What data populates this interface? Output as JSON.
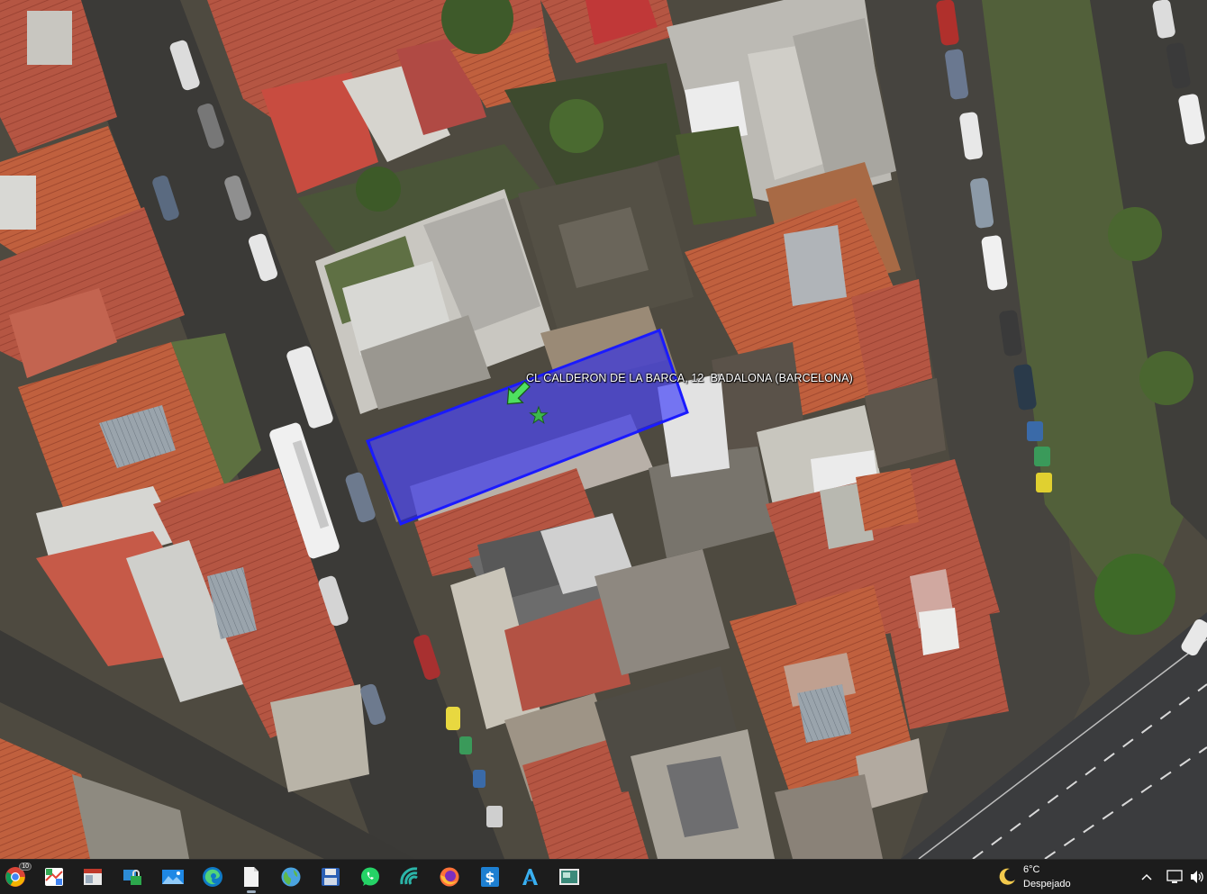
{
  "map": {
    "place_label": "CL CALDERON DE LA BARCA, 12  BADALONA (BARCELONA)",
    "parcel_color": "#1a1aff",
    "marker_color": "#4ee060"
  },
  "taskbar": {
    "apps": [
      {
        "name": "chrome-icon",
        "badge": "10"
      },
      {
        "name": "maps-icon"
      },
      {
        "name": "window-icon"
      },
      {
        "name": "screen-lock-icon"
      },
      {
        "name": "photos-icon"
      },
      {
        "name": "edge-icon"
      },
      {
        "name": "document-icon"
      },
      {
        "name": "globe-icon"
      },
      {
        "name": "save-icon"
      },
      {
        "name": "whatsapp-icon"
      },
      {
        "name": "signal-icon"
      },
      {
        "name": "firefox-icon"
      },
      {
        "name": "dollar-app-icon"
      },
      {
        "name": "autocad-icon"
      },
      {
        "name": "display-icon"
      }
    ],
    "weather": {
      "temperature": "6°C",
      "description": "Despejado"
    }
  }
}
